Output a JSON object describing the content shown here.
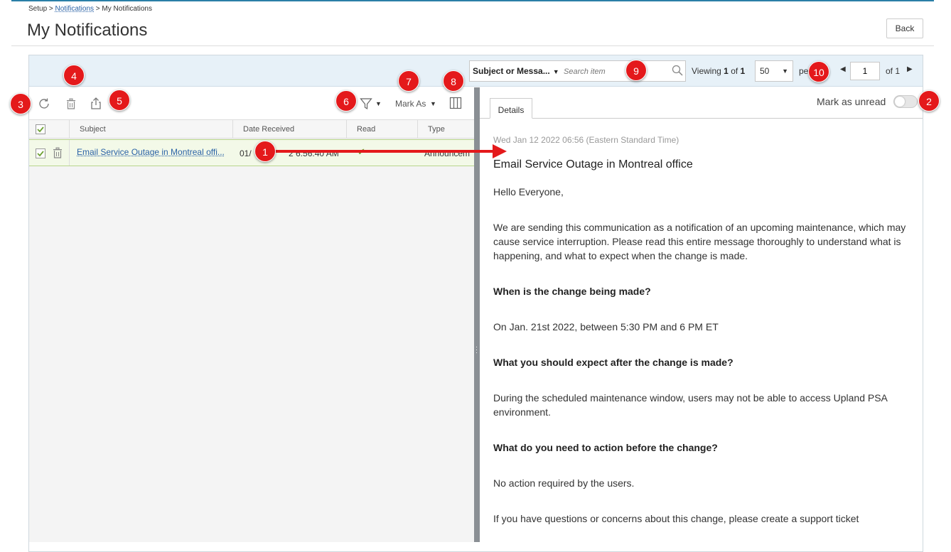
{
  "breadcrumb": {
    "root": "Setup",
    "sep1": ">",
    "link": "Notifications",
    "sep2": ">",
    "current": "My Notifications"
  },
  "page_title": "My Notifications",
  "back_button": "Back",
  "search": {
    "field_select": "Subject or Messa...",
    "placeholder": "Search item"
  },
  "pager": {
    "viewing_label": "Viewing",
    "viewing_current": "1",
    "viewing_of": "of",
    "viewing_total": "1",
    "per_page_value": "50",
    "per_page_label": "pe",
    "page_value": "1",
    "of_pages": "of 1"
  },
  "toolbar": {
    "mark_as_label": "Mark As"
  },
  "grid": {
    "columns": [
      "Subject",
      "Date Received",
      "Read",
      "Type"
    ],
    "rows": [
      {
        "subject": "Email Service Outage in Montreal offi...",
        "date_start": "01/",
        "date_end": "2 6:56:40 AM",
        "read": "✔",
        "type": "Announcem"
      }
    ]
  },
  "details": {
    "tab_label": "Details",
    "mark_unread_label": "Mark as unread",
    "date": "Wed Jan 12 2022 06:56 (Eastern Standard Time)",
    "subject": "Email Service Outage in Montreal office",
    "paragraphs": [
      "Hello Everyone,",
      "We are sending this communication as a notification of an upcoming maintenance, which may cause service interruption. Please read this entire message thoroughly to understand what is happening, and what to expect when the change is made.",
      "When is the change being made?",
      "On Jan. 21st 2022, between 5:30 PM and 6 PM ET",
      "What you should expect after the change is made?",
      "During the scheduled maintenance window, users may not be able to access Upland PSA environment.",
      "What do you need to action before the change?",
      "No action required by the users.",
      "If you have questions or concerns about this change, please create a support ticket"
    ]
  },
  "callouts": [
    "1",
    "2",
    "3",
    "4",
    "5",
    "6",
    "7",
    "8",
    "9",
    "10"
  ],
  "colors": {
    "accent_link": "#2a62a6",
    "callout_red": "#e4191b",
    "row_highlight": "#f3f9e8",
    "header_bar": "#e7f1f8",
    "check_green": "#6ea234"
  },
  "icons": [
    "refresh-icon",
    "delete-icon",
    "export-icon",
    "filter-icon",
    "columns-icon",
    "search-icon",
    "row-delete-icon",
    "prev-page-icon",
    "next-page-icon"
  ]
}
